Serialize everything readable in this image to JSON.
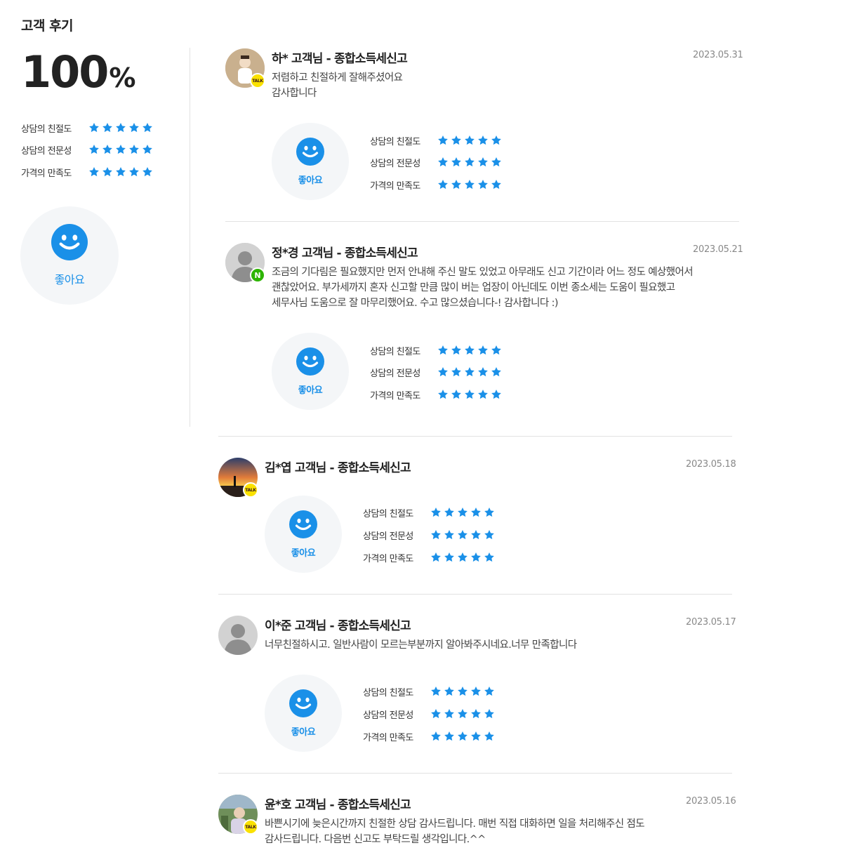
{
  "header": {
    "title": "고객 후기"
  },
  "summary": {
    "percent": "100",
    "percent_unit": "%",
    "ratings": [
      {
        "label": "상담의 친절도",
        "stars": 5
      },
      {
        "label": "상담의 전문성",
        "stars": 5
      },
      {
        "label": "가격의 만족도",
        "stars": 5
      }
    ],
    "badge_label": "좋아요",
    "badge_icon": "smile-icon"
  },
  "colors": {
    "star": "#1a90e8",
    "accent": "#1a90e8",
    "talk_badge": "#fae100",
    "naver_badge": "#2db400"
  },
  "reviews": [
    {
      "name": "하* 고객님 - 종합소득세신고",
      "date": "2023.05.31",
      "text": [
        "저렴하고 친절하게 잘해주셨어요",
        "감사합니다"
      ],
      "badge": "TALK",
      "badge_label": "좋아요",
      "ratings": [
        {
          "label": "상담의 친절도",
          "stars": 5
        },
        {
          "label": "상담의 전문성",
          "stars": 5
        },
        {
          "label": "가격의 만족도",
          "stars": 5
        }
      ]
    },
    {
      "name": "정*경 고객님 - 종합소득세신고",
      "date": "2023.05.21",
      "text": [
        "조금의 기다림은 필요했지만 먼저 안내해 주신 말도 있었고 아무래도 신고 기간이라 어느 정도 예상했어서",
        "괜찮았어요. 부가세까지 혼자 신고할 만큼 많이 버는 업장이 아닌데도 이번 종소세는 도움이 필요했고",
        "세무사님 도움으로 잘 마무리했어요. 수고 많으셨습니다-! 감사합니다 :)"
      ],
      "badge": "N",
      "badge_label": "좋아요",
      "ratings": [
        {
          "label": "상담의 친절도",
          "stars": 5
        },
        {
          "label": "상담의 전문성",
          "stars": 5
        },
        {
          "label": "가격의 만족도",
          "stars": 5
        }
      ]
    },
    {
      "name": "김*엽 고객님 - 종합소득세신고",
      "date": "2023.05.18",
      "text": [],
      "badge": "TALK",
      "badge_label": "좋아요",
      "ratings": [
        {
          "label": "상담의 친절도",
          "stars": 5
        },
        {
          "label": "상담의 전문성",
          "stars": 5
        },
        {
          "label": "가격의 만족도",
          "stars": 5
        }
      ]
    },
    {
      "name": "이*준 고객님 - 종합소득세신고",
      "date": "2023.05.17",
      "text": [
        "너무친절하시고. 일반사람이 모르는부분까지 알아봐주시네요.너무 만족합니다"
      ],
      "badge": "",
      "badge_label": "좋아요",
      "ratings": [
        {
          "label": "상담의 친절도",
          "stars": 5
        },
        {
          "label": "상담의 전문성",
          "stars": 5
        },
        {
          "label": "가격의 만족도",
          "stars": 5
        }
      ]
    },
    {
      "name": "윤*호 고객님 - 종합소득세신고",
      "date": "2023.05.16",
      "text": [
        "바쁜시기에 늦은시간까지 친절한 상담 감사드립니다. 매번 직접 대화하면 일을 처리해주신 점도",
        "감사드립니다. 다음번 신고도 부탁드릴 생각입니다.^^"
      ],
      "badge": "TALK",
      "badge_label": "좋아요",
      "ratings": []
    }
  ]
}
